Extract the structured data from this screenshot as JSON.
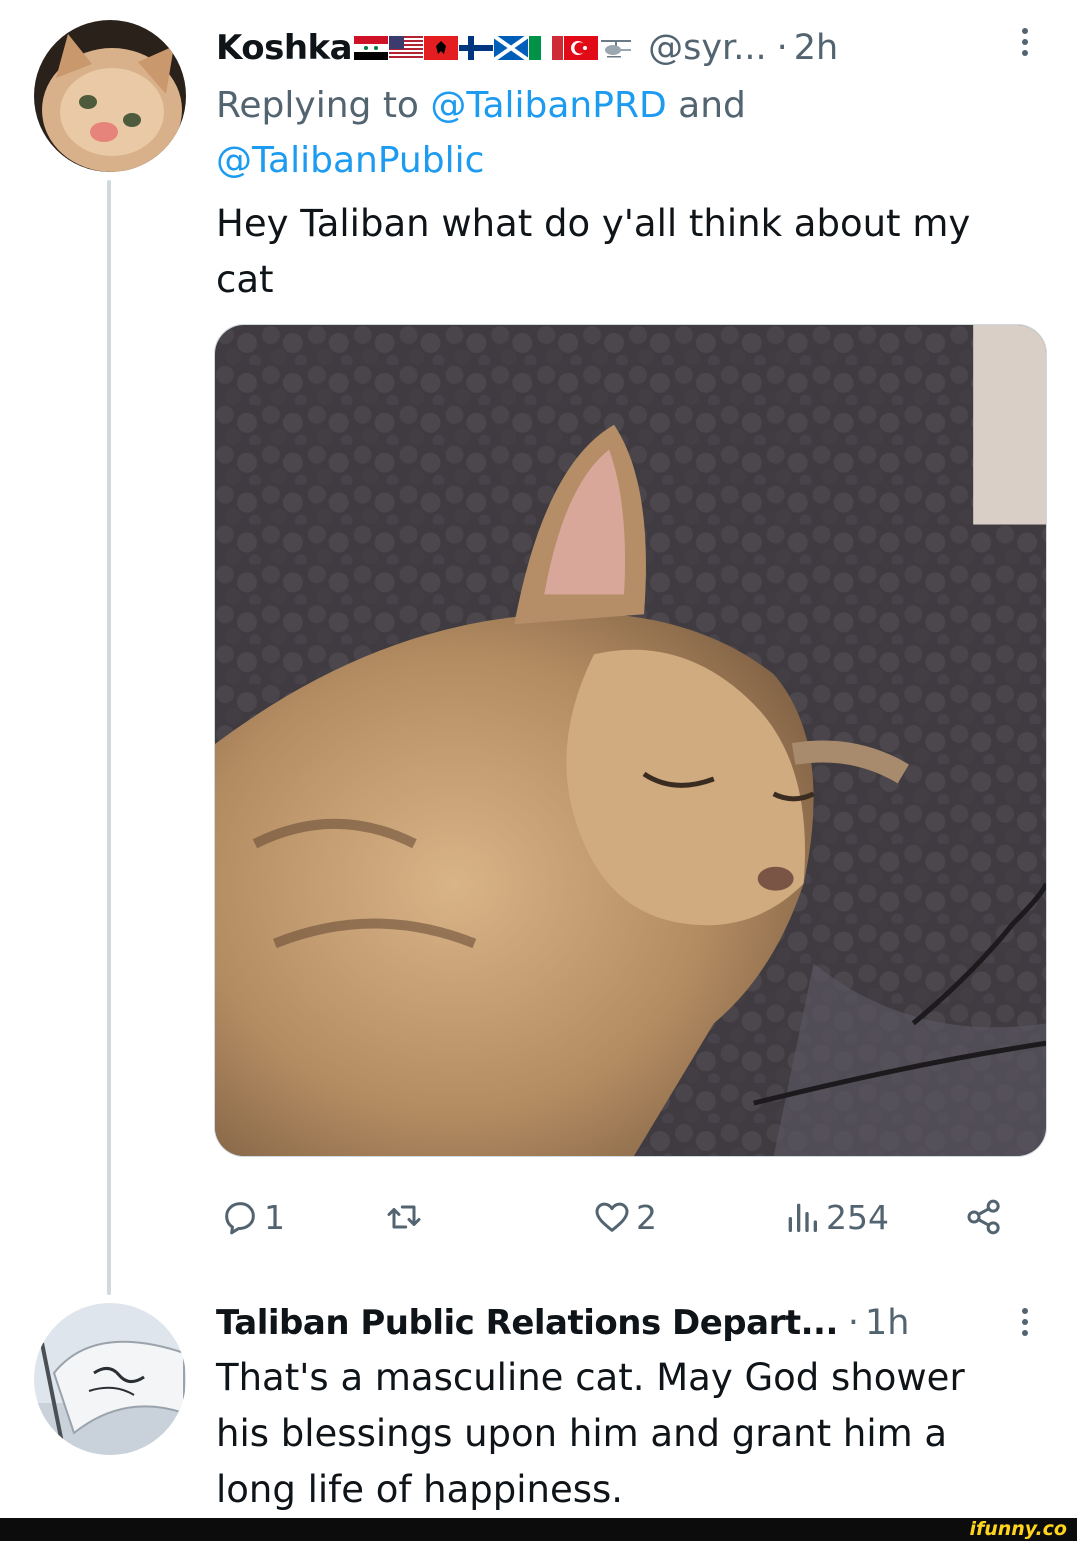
{
  "tweet": {
    "author_name": "Koshka",
    "flags": [
      "syria-flag",
      "usa-flag",
      "albania-flag",
      "finland-flag",
      "scotland-flag",
      "italy-flag",
      "turkey-flag",
      "helicopter-emoji"
    ],
    "handle": "@syr...",
    "dot": "·",
    "time": "2h",
    "replying_prefix": "Replying to ",
    "mention_1": "@TalibanPRD",
    "replying_and": " and",
    "mention_2": "@TalibanPublic",
    "text": "Hey Taliban what do y'all think about my cat",
    "media_alt": "photo of a sleeping tabby cat",
    "actions": {
      "reply_count": "1",
      "retweet_count": "",
      "like_count": "2",
      "views_count": "254"
    }
  },
  "reply": {
    "author_name": "Taliban Public Relations Depart...",
    "dot": "·",
    "time": "1h",
    "text": "That's a masculine cat. May God shower his blessings upon him and grant him a long life of happiness."
  },
  "footer": {
    "watermark": "ifunny.co"
  },
  "colors": {
    "text_primary": "#0f1419",
    "text_secondary": "#536471",
    "link": "#1d9bf0",
    "divider": "#cfd9de",
    "watermark": "#ffd41c"
  }
}
